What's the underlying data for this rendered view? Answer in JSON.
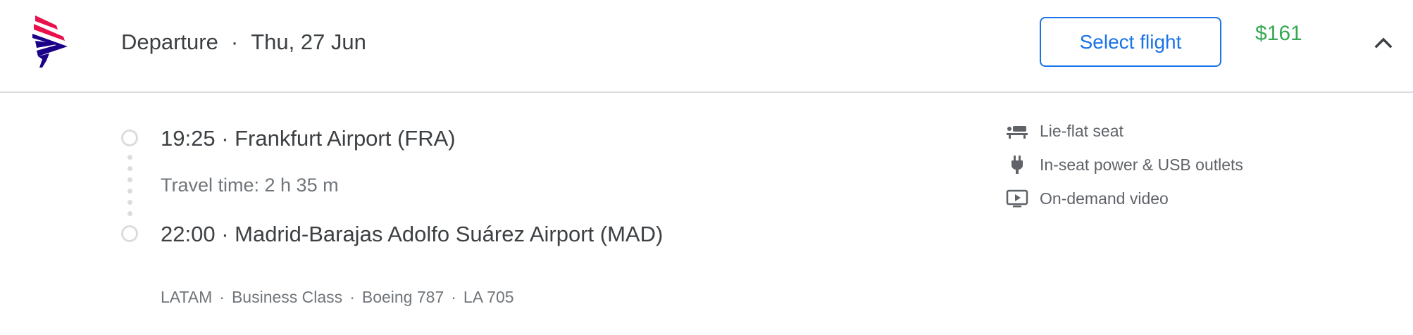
{
  "header": {
    "title": "Departure",
    "separator": "·",
    "date": "Thu, 27 Jun",
    "select_label": "Select flight",
    "price": "$161",
    "collapse_icon": "chevron-up-icon",
    "airline_logo_icon": "latam-logo-icon"
  },
  "itinerary": {
    "departure": "19:25 · Frankfurt Airport (FRA)",
    "travel_time": "Travel time: 2 h 35 m",
    "arrival": "22:00 · Madrid-Barajas Adolfo Suárez Airport (MAD)"
  },
  "details": [
    "LATAM",
    "Business Class",
    "Boeing 787",
    "LA 705"
  ],
  "amenities": [
    {
      "icon": "lie-flat-seat-icon",
      "label": "Lie-flat seat"
    },
    {
      "icon": "power-plug-icon",
      "label": "In-seat power & USB outlets"
    },
    {
      "icon": "video-icon",
      "label": "On-demand video"
    }
  ],
  "colors": {
    "accent": "#1a73e8",
    "price": "#34a853",
    "logo_red": "#e8114b",
    "logo_navy": "#1b0088"
  }
}
